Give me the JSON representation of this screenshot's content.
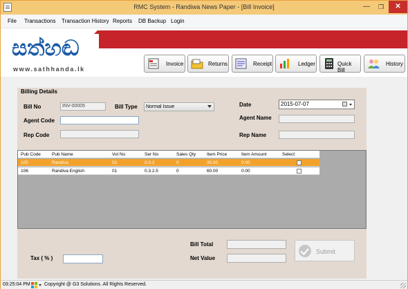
{
  "window": {
    "title": "RMC System - Randiwa News Paper - [Bill Invoice]"
  },
  "menu": [
    "File",
    "Transactions",
    "Transaction History",
    "Reports",
    "DB Backup",
    "Login"
  ],
  "brand": {
    "logo_text": "සත්හඬ",
    "url": "www.sathhanda.lk"
  },
  "toolbar": [
    {
      "label": "Invoice",
      "icon": "invoice-icon"
    },
    {
      "label": "Returns",
      "icon": "returns-icon"
    },
    {
      "label": "Receipt",
      "icon": "receipt-icon"
    },
    {
      "label": "Ledger",
      "icon": "ledger-icon"
    },
    {
      "label": "Quick Bill",
      "icon": "calculator-icon"
    },
    {
      "label": "History",
      "icon": "history-icon"
    }
  ],
  "billing": {
    "section_title": "Billing Details",
    "bill_no_label": "Bill No",
    "bill_no": "INV-00005",
    "bill_type_label": "Bill Type",
    "bill_type": "Normal Issue",
    "date_label": "Date",
    "date": "2015-07-07",
    "agent_code_label": "Agent Code",
    "agent_code": "",
    "agent_name_label": "Agent Name",
    "agent_name": "",
    "rep_code_label": "Rep Code",
    "rep_code": "",
    "rep_name_label": "Rep Name",
    "rep_name": ""
  },
  "grid": {
    "columns": [
      "Pub Code",
      "Pub Name",
      "Vol No",
      "Ser No",
      "Sales Qty",
      "Item Price",
      "Item Amount",
      "Select"
    ],
    "rows": [
      {
        "pub_code": "105",
        "pub_name": "Randiva",
        "vol_no": "02",
        "ser_no": "0.0.2",
        "sales_qty": "0",
        "item_price": "30.00",
        "item_amount": "0.00",
        "selected": false
      },
      {
        "pub_code": "106",
        "pub_name": "Randiva English",
        "vol_no": "01",
        "ser_no": "0.3.2.5",
        "sales_qty": "0",
        "item_price": "60.00",
        "item_amount": "0.00",
        "selected": false
      }
    ]
  },
  "totals": {
    "tax_label": "Tax ( % )",
    "tax": "",
    "bill_total_label": "Bill Total",
    "bill_total": "",
    "net_value_label": "Net Value",
    "net_value": "",
    "submit_label": "Submit"
  },
  "status": {
    "time": "03:25:04 PM",
    "copyright": "Copyright @ G3 Solutions.  All  Rights Reserved."
  },
  "colors": {
    "title_bar": "#f4c978",
    "brand_red": "#c6232b",
    "brand_blue": "#1b5aa6",
    "selected_row": "#f2a22b",
    "panel": "#e3d9d0"
  }
}
